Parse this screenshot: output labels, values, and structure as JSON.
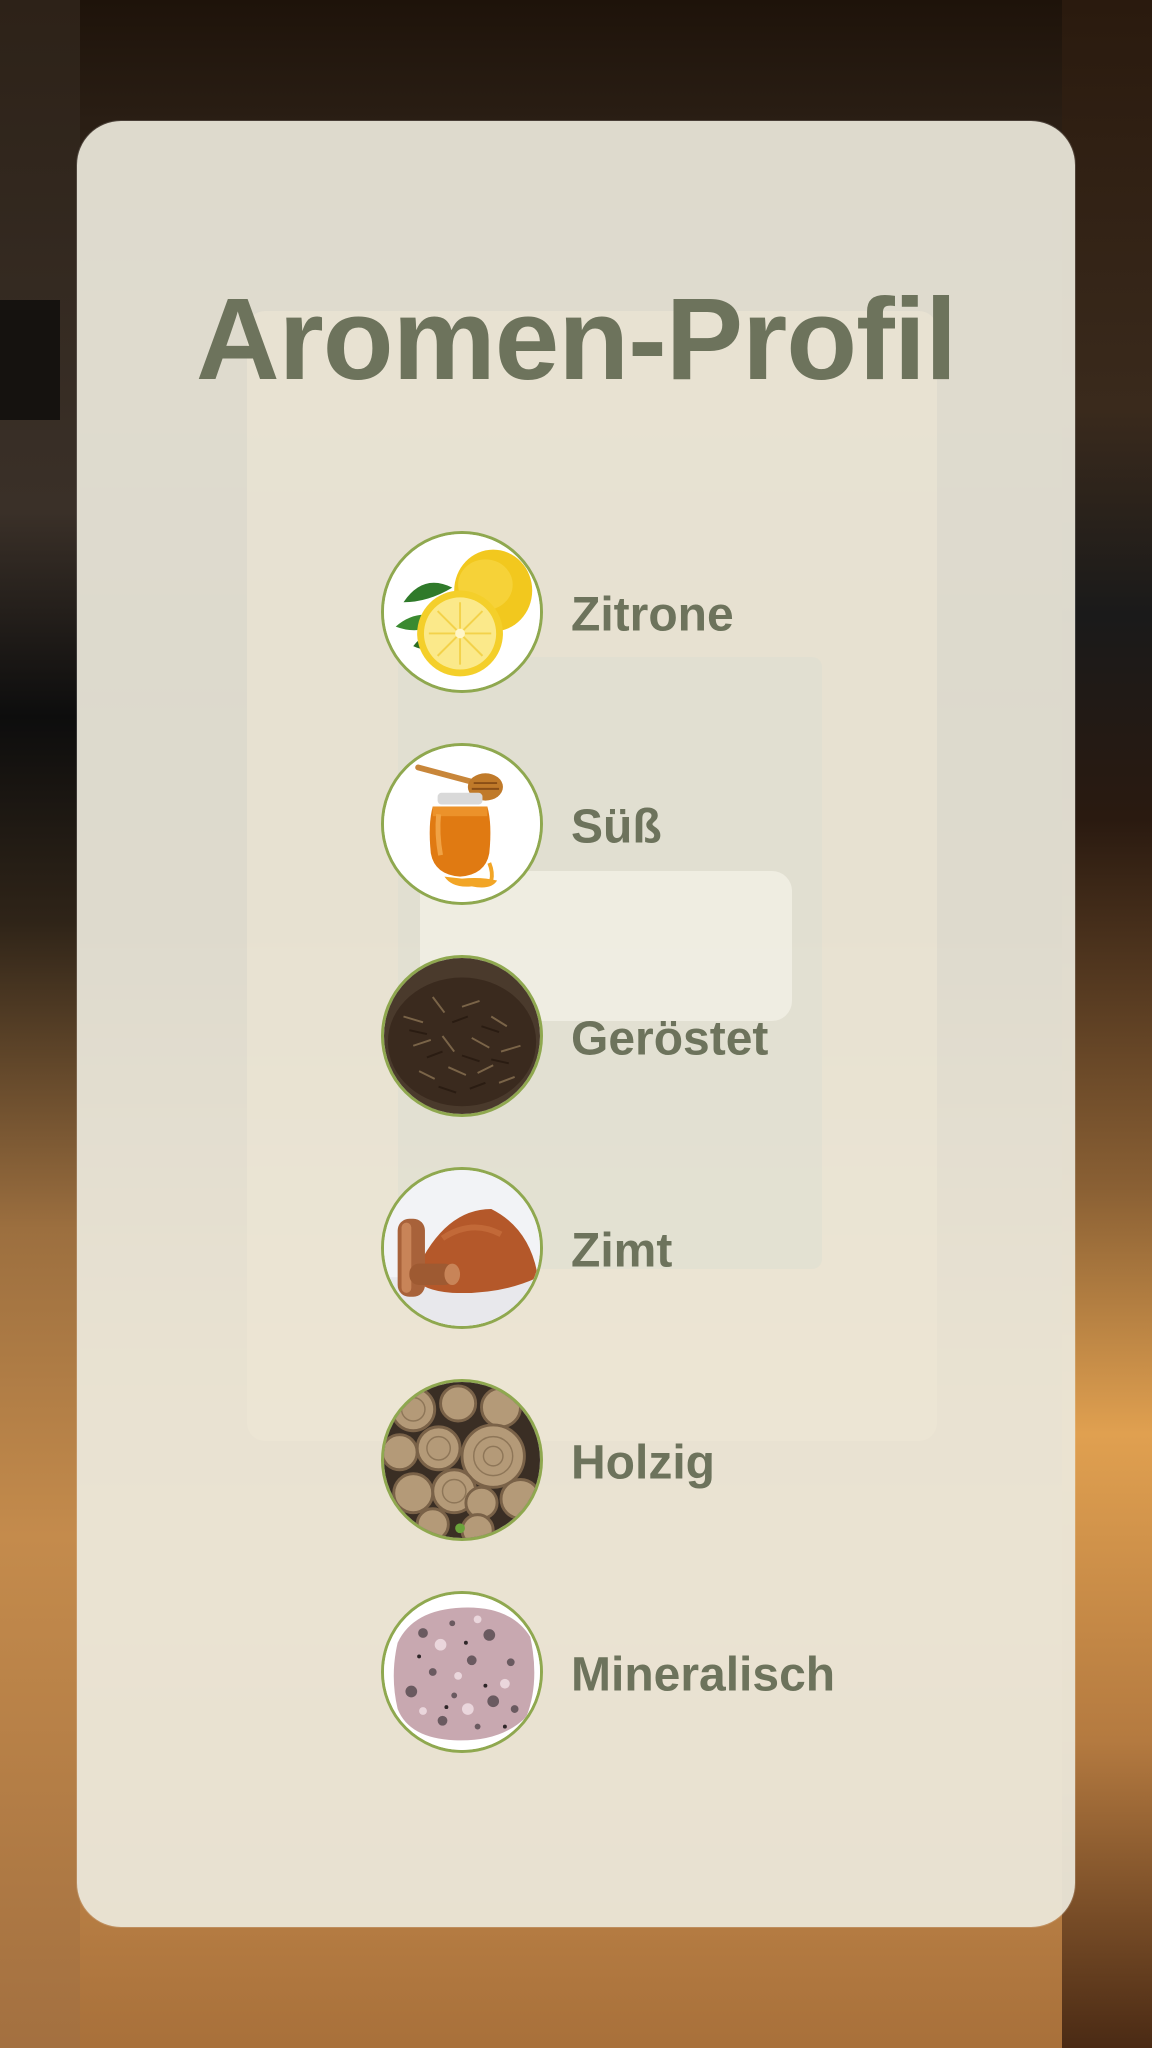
{
  "card": {
    "title": "Aromen-Profil"
  },
  "aromas": [
    {
      "label": "Zitrone",
      "icon": "lemon-icon"
    },
    {
      "label": "Süß",
      "icon": "honey-jar-icon"
    },
    {
      "label": "Geröstet",
      "icon": "roasted-tea-leaves-icon"
    },
    {
      "label": "Zimt",
      "icon": "cinnamon-icon"
    },
    {
      "label": "Holzig",
      "icon": "wood-logs-icon"
    },
    {
      "label": "Mineralisch",
      "icon": "mineral-stone-icon"
    }
  ],
  "colors": {
    "text": "#6d735c",
    "ring": "#8fa84f",
    "card": "#ece8dc"
  }
}
